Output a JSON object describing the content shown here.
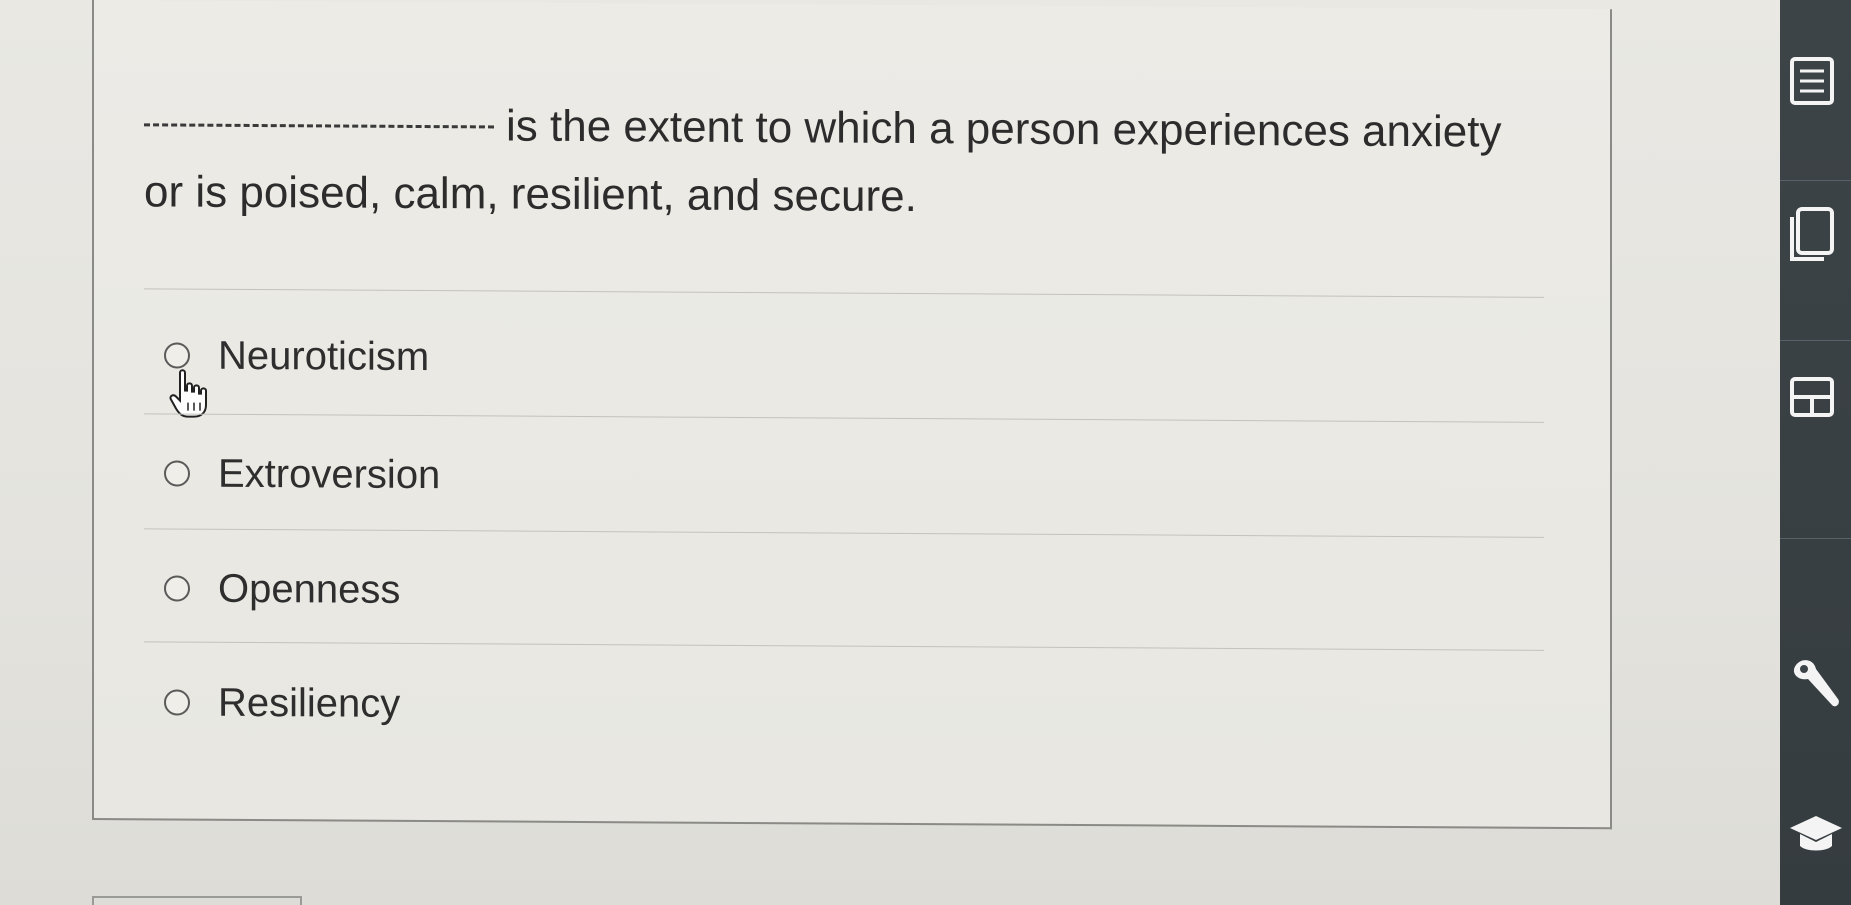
{
  "question": {
    "text": "is the extent to which a person experiences anxiety or is poised, calm, resilient, and secure."
  },
  "options": [
    {
      "label": "Neuroticism"
    },
    {
      "label": "Extroversion"
    },
    {
      "label": "Openness"
    },
    {
      "label": "Resiliency"
    }
  ],
  "sidebar": {
    "icons": [
      "notes-icon",
      "documents-icon",
      "gradebook-icon",
      "wrench-icon",
      "graduation-cap-icon"
    ]
  },
  "colors": {
    "sidebar_bg": "#3d4448",
    "card_bg": "#ecebe6",
    "text": "#2c2c2c"
  }
}
